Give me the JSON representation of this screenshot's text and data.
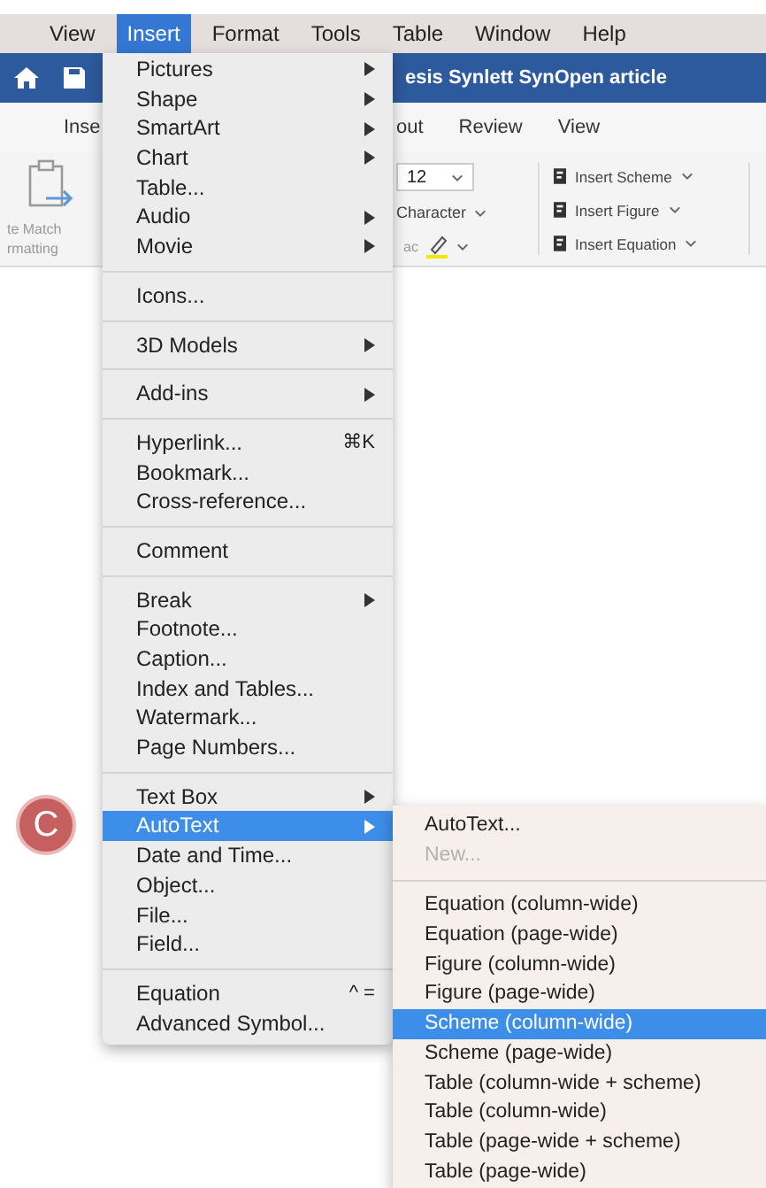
{
  "menubar": [
    {
      "label": "View",
      "selected": false
    },
    {
      "label": "Insert",
      "selected": true
    },
    {
      "label": "Format",
      "selected": false
    },
    {
      "label": "Tools",
      "selected": false
    },
    {
      "label": "Table",
      "selected": false
    },
    {
      "label": "Window",
      "selected": false
    },
    {
      "label": "Help",
      "selected": false
    }
  ],
  "title_bar": {
    "title": "esis Synlett SynOpen article"
  },
  "ribbon_tabs": [
    "Inse",
    "out",
    "Review",
    "View"
  ],
  "ribbon": {
    "paste_format_label": [
      "te Match",
      "rmatting"
    ],
    "font_size": "12",
    "character_button": "Character",
    "text_fragment": "ac",
    "insert_buttons": [
      "Insert Scheme",
      "Insert Figure",
      "Insert Equation"
    ]
  },
  "insert_menu": {
    "groups": [
      [
        {
          "label": "Pictures",
          "submenu": true,
          "selected": false
        },
        {
          "label": "Shape",
          "submenu": true,
          "selected": false
        },
        {
          "label": "SmartArt",
          "submenu": true,
          "selected": false
        },
        {
          "label": "Chart",
          "submenu": true,
          "selected": false
        },
        {
          "label": "Table...",
          "submenu": false,
          "selected": false
        },
        {
          "label": "Audio",
          "submenu": true,
          "selected": false
        },
        {
          "label": "Movie",
          "submenu": true,
          "selected": false
        }
      ],
      [
        {
          "label": "Icons...",
          "submenu": false,
          "selected": false
        }
      ],
      [
        {
          "label": "3D Models",
          "submenu": true,
          "selected": false
        }
      ],
      [
        {
          "label": "Add-ins",
          "submenu": true,
          "selected": false
        }
      ],
      [
        {
          "label": "Hyperlink...",
          "shortcut": "⌘K",
          "submenu": false,
          "selected": false
        },
        {
          "label": "Bookmark...",
          "submenu": false,
          "selected": false
        },
        {
          "label": "Cross-reference...",
          "submenu": false,
          "selected": false
        }
      ],
      [
        {
          "label": "Comment",
          "submenu": false,
          "selected": false
        }
      ],
      [
        {
          "label": "Break",
          "submenu": true,
          "selected": false
        },
        {
          "label": "Footnote...",
          "submenu": false,
          "selected": false
        },
        {
          "label": "Caption...",
          "submenu": false,
          "selected": false
        },
        {
          "label": "Index and Tables...",
          "submenu": false,
          "selected": false
        },
        {
          "label": "Watermark...",
          "submenu": false,
          "selected": false
        },
        {
          "label": "Page Numbers...",
          "submenu": false,
          "selected": false
        }
      ],
      [
        {
          "label": "Text Box",
          "submenu": true,
          "selected": false
        },
        {
          "label": "AutoText",
          "submenu": true,
          "selected": true
        },
        {
          "label": "Date and Time...",
          "submenu": false,
          "selected": false
        },
        {
          "label": "Object...",
          "submenu": false,
          "selected": false
        },
        {
          "label": "File...",
          "submenu": false,
          "selected": false
        },
        {
          "label": "Field...",
          "submenu": false,
          "selected": false
        }
      ],
      [
        {
          "label": "Equation",
          "shortcut": "^ =",
          "submenu": false,
          "selected": false
        },
        {
          "label": "Advanced Symbol...",
          "submenu": false,
          "selected": false
        }
      ]
    ]
  },
  "autotext_submenu": {
    "groups": [
      [
        {
          "label": "AutoText...",
          "disabled": false,
          "selected": false
        },
        {
          "label": "New...",
          "disabled": true,
          "selected": false
        }
      ],
      [
        {
          "label": "Equation (column-wide)",
          "disabled": false,
          "selected": false
        },
        {
          "label": "Equation (page-wide)",
          "disabled": false,
          "selected": false
        },
        {
          "label": "Figure (column-wide)",
          "disabled": false,
          "selected": false
        },
        {
          "label": "Figure (page-wide)",
          "disabled": false,
          "selected": false
        },
        {
          "label": "Scheme (column-wide)",
          "disabled": false,
          "selected": true
        },
        {
          "label": "Scheme (page-wide)",
          "disabled": false,
          "selected": false
        },
        {
          "label": "Table (column-wide + scheme)",
          "disabled": false,
          "selected": false
        },
        {
          "label": "Table (column-wide)",
          "disabled": false,
          "selected": false
        },
        {
          "label": "Table (page-wide + scheme)",
          "disabled": false,
          "selected": false
        },
        {
          "label": "Table (page-wide)",
          "disabled": false,
          "selected": false
        }
      ]
    ]
  },
  "annotation": {
    "label": "C"
  }
}
